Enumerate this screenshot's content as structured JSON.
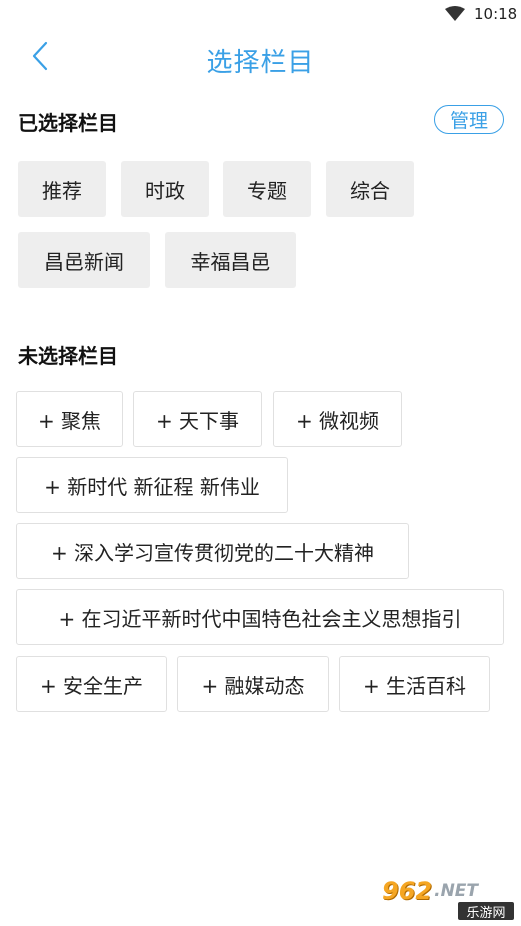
{
  "status_bar": {
    "time": "10:18",
    "wifi_icon": "wifi-icon"
  },
  "header": {
    "title": "选择栏目",
    "back_icon": "chevron-left-icon"
  },
  "selected": {
    "title": "已选择栏目",
    "manage_label": "管理",
    "items": [
      "推荐",
      "时政",
      "专题",
      "综合",
      "昌邑新闻",
      "幸福昌邑"
    ]
  },
  "unselected": {
    "title": "未选择栏目",
    "items": [
      "+ 聚焦",
      "+ 天下事",
      "+ 微视频",
      "+ 新时代 新征程 新伟业",
      "+ 深入学习宣传贯彻党的二十大精神",
      "+ 在习近平新时代中国特色社会主义思想指引",
      "+ 安全生产",
      "+ 融媒动态",
      "+ 生活百科"
    ]
  },
  "watermark": {
    "brand": "962",
    "domain": ".NET",
    "tagline": "乐游网"
  },
  "colors": {
    "accent": "#3aa0e6",
    "chip_bg": "#eeeeee",
    "text": "#222222"
  }
}
